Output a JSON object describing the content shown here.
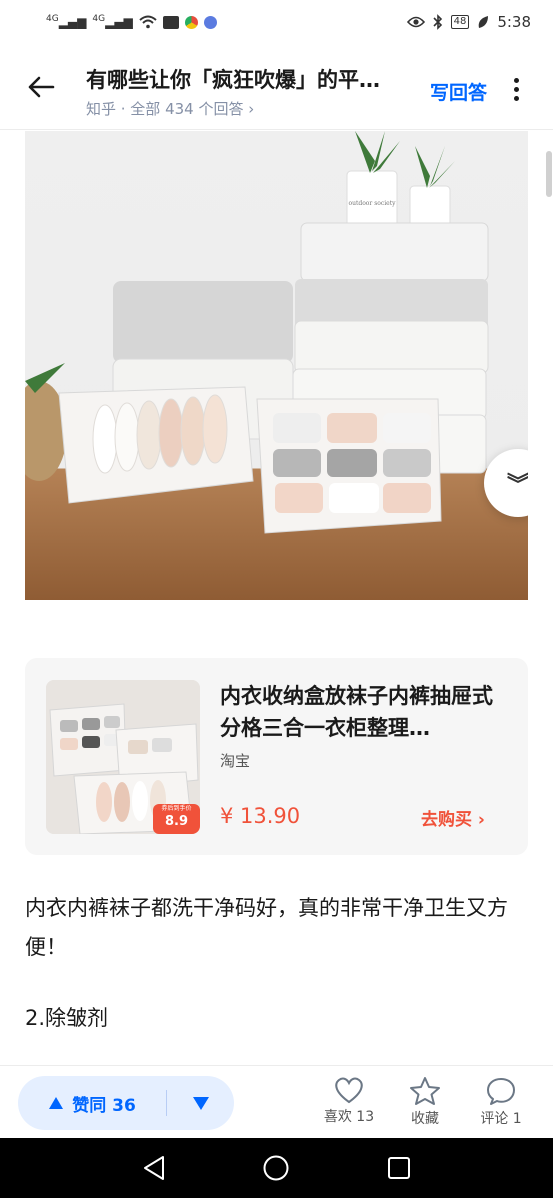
{
  "status_bar": {
    "signal_label_1": "4G",
    "signal_label_2": "4G",
    "battery": "48",
    "time": "5:38"
  },
  "header": {
    "title": "有哪些让你「疯狂吹爆」的平…",
    "subtitle": "知乎 · 全部 434 个回答 ›",
    "write_answer": "写回答",
    "back_icon": "arrow-left-icon",
    "more_icon": "vertical-dots-icon"
  },
  "photo": {
    "label_on_jar": "outdoor society"
  },
  "product": {
    "title": "内衣收纳盒放袜子内裤抽屉式分格三合一衣柜整理…",
    "source": "淘宝",
    "price": "¥ 13.90",
    "buy_label": "去购买 ›",
    "tag_small": "券后到手价",
    "tag_price": "8.9"
  },
  "body_text": {
    "paragraph_1": "内衣内裤袜子都洗干净码好，真的非常干净卫生又方便！",
    "paragraph_2": "2.除皱剂"
  },
  "action_bar": {
    "upvote_label": "赞同 36",
    "like_label": "喜欢 13",
    "favorite_label": "收藏",
    "comment_label": "评论 1"
  },
  "colors": {
    "accent_blue": "#0066ff",
    "price_orange": "#f0523a",
    "vote_bg": "#e5efff"
  }
}
